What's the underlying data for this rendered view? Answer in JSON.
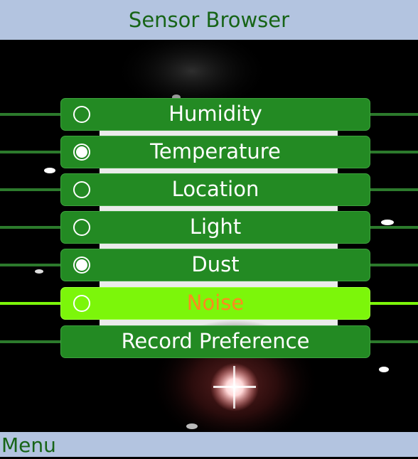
{
  "window": {
    "title": "Sensor Browser"
  },
  "menu": {
    "items": [
      {
        "label": "Humidity",
        "selected": false,
        "focused": false
      },
      {
        "label": "Temperature",
        "selected": true,
        "focused": false
      },
      {
        "label": "Location",
        "selected": false,
        "focused": false
      },
      {
        "label": "Light",
        "selected": false,
        "focused": false
      },
      {
        "label": "Dust",
        "selected": true,
        "focused": false
      },
      {
        "label": "Noise",
        "selected": false,
        "focused": true
      },
      {
        "label": "Record Preference",
        "focused": false,
        "has_radio": false
      }
    ]
  },
  "softkeys": {
    "left": "Menu"
  },
  "colors": {
    "title_bar": "#b3c4e0",
    "title_text": "#176417",
    "item_green": "#238a23",
    "focus_green": "#7cf60a",
    "focus_text": "#ff8a1e"
  }
}
